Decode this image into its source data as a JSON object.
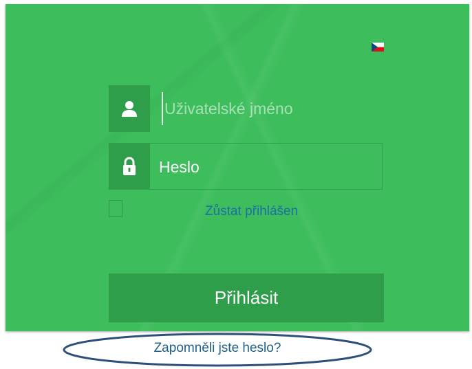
{
  "colors": {
    "panel": "#3dbd5c",
    "icon_box": "#2e9e4a",
    "button": "#2e9e4a",
    "link_blue": "#1d6fa8",
    "ellipse": "#2e4f7a"
  },
  "language": {
    "icon": "czech-flag-icon"
  },
  "form": {
    "username": {
      "placeholder": "Uživatelské jméno",
      "value": "",
      "icon": "user-icon"
    },
    "password": {
      "value": "Heslo",
      "icon": "lock-icon"
    },
    "remember": {
      "label": "Zůstat přihlášen",
      "checked": false
    },
    "submit_label": "Přihlásit"
  },
  "footer": {
    "forgot_label": "Zapomněli jste heslo?"
  }
}
